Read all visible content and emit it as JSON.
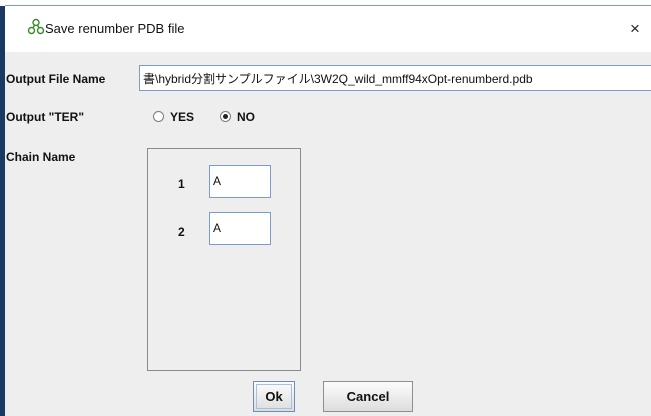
{
  "dialog": {
    "title": "Save renumber PDB file",
    "close_symbol": "×",
    "icon": "network-nodes-icon"
  },
  "output_file": {
    "label": "Output File Name",
    "value": "書\\hybrid分割サンプルファイル\\3W2Q_wild_mmff94xOpt-renumberd.pdb"
  },
  "output_ter": {
    "label": "Output \"TER\"",
    "options": [
      {
        "label": "YES",
        "selected": false
      },
      {
        "label": "NO",
        "selected": true
      }
    ]
  },
  "chain_name": {
    "label": "Chain Name",
    "rows": [
      {
        "number": "1",
        "value": "A"
      },
      {
        "number": "2",
        "value": "A"
      }
    ]
  },
  "buttons": {
    "ok": "Ok",
    "cancel": "Cancel"
  },
  "colors": {
    "accent_border": "#7a9cc8",
    "icon_green": "#3a8a2a",
    "window_bg": "#eeeeee",
    "desktop_edge": "#1b3a63"
  }
}
